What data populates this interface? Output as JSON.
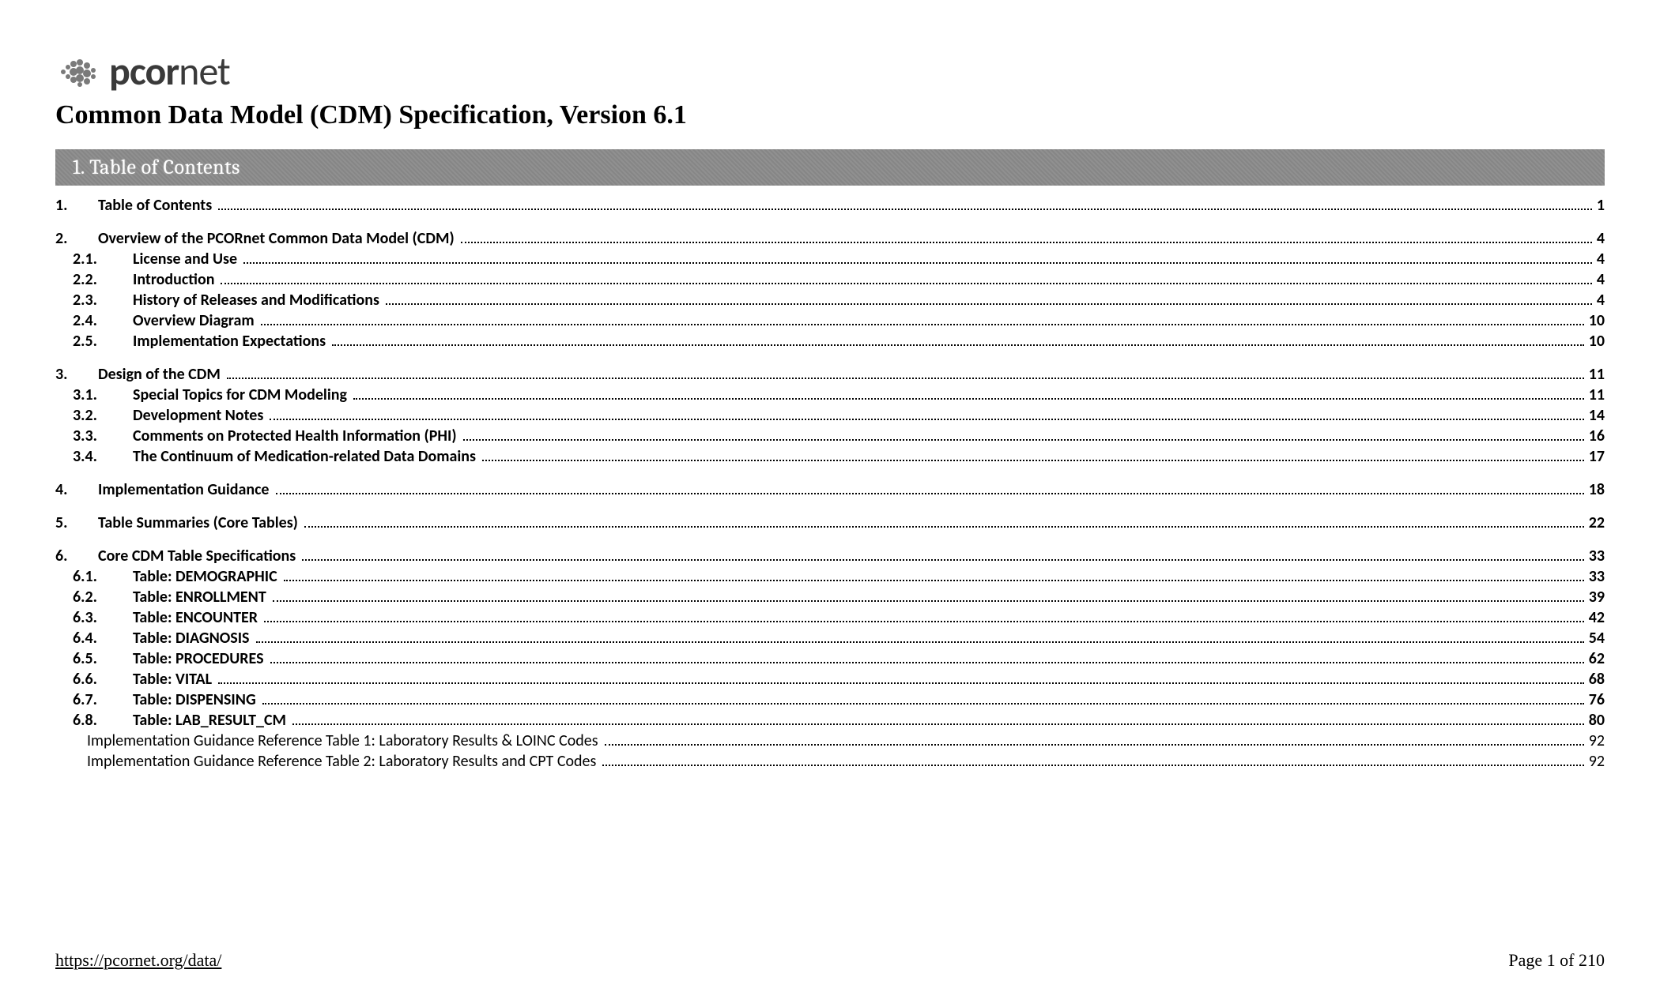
{
  "header": {
    "brand_bold": "pcor",
    "brand_light": "net",
    "subtitle": "Common Data Model (CDM) Specification, Version 6.1"
  },
  "banner": {
    "title": "1. Table of Contents"
  },
  "toc": [
    {
      "num": "1.",
      "label": "Table of Contents",
      "page": "1",
      "children": []
    },
    {
      "num": "2.",
      "label": "Overview of the PCORnet Common Data Model (CDM)",
      "page": "4",
      "children": [
        {
          "num": "2.1.",
          "label": "License and Use",
          "page": "4"
        },
        {
          "num": "2.2.",
          "label": "Introduction",
          "page": "4"
        },
        {
          "num": "2.3.",
          "label": "History of Releases and Modifications",
          "page": "4"
        },
        {
          "num": "2.4.",
          "label": "Overview Diagram",
          "page": "10"
        },
        {
          "num": "2.5.",
          "label": "Implementation Expectations",
          "page": "10"
        }
      ]
    },
    {
      "num": "3.",
      "label": "Design of the CDM",
      "page": "11",
      "children": [
        {
          "num": "3.1.",
          "label": "Special Topics for CDM Modeling",
          "page": "11"
        },
        {
          "num": "3.2.",
          "label": "Development Notes",
          "page": "14"
        },
        {
          "num": "3.3.",
          "label": "Comments on Protected Health Information (PHI)",
          "page": "16"
        },
        {
          "num": "3.4.",
          "label": "The Continuum of Medication-related Data Domains",
          "page": "17"
        }
      ]
    },
    {
      "num": "4.",
      "label": "Implementation Guidance",
      "page": "18",
      "children": []
    },
    {
      "num": "5.",
      "label": "Table Summaries (Core Tables)",
      "page": "22",
      "children": []
    },
    {
      "num": "6.",
      "label": "Core CDM Table Specifications",
      "page": "33",
      "children": [
        {
          "num": "6.1.",
          "label": "Table: DEMOGRAPHIC",
          "page": "33"
        },
        {
          "num": "6.2.",
          "label": "Table: ENROLLMENT",
          "page": "39"
        },
        {
          "num": "6.3.",
          "label": "Table: ENCOUNTER",
          "page": "42"
        },
        {
          "num": "6.4.",
          "label": "Table: DIAGNOSIS",
          "page": "54"
        },
        {
          "num": "6.5.",
          "label": "Table: PROCEDURES",
          "page": "62"
        },
        {
          "num": "6.6.",
          "label": "Table: VITAL",
          "page": "68"
        },
        {
          "num": "6.7.",
          "label": "Table: DISPENSING",
          "page": "76"
        },
        {
          "num": "6.8.",
          "label": "Table: LAB_RESULT_CM",
          "page": "80"
        },
        {
          "num": "",
          "label": "Implementation Guidance Reference Table 1: Laboratory Results & LOINC Codes",
          "page": "92",
          "unnumbered": true
        },
        {
          "num": "",
          "label": "Implementation Guidance Reference Table 2: Laboratory Results and CPT Codes",
          "page": "92",
          "unnumbered": true
        }
      ]
    }
  ],
  "footer": {
    "link": "https://pcornet.org/data/",
    "page_indicator": "Page 1 of 210"
  }
}
